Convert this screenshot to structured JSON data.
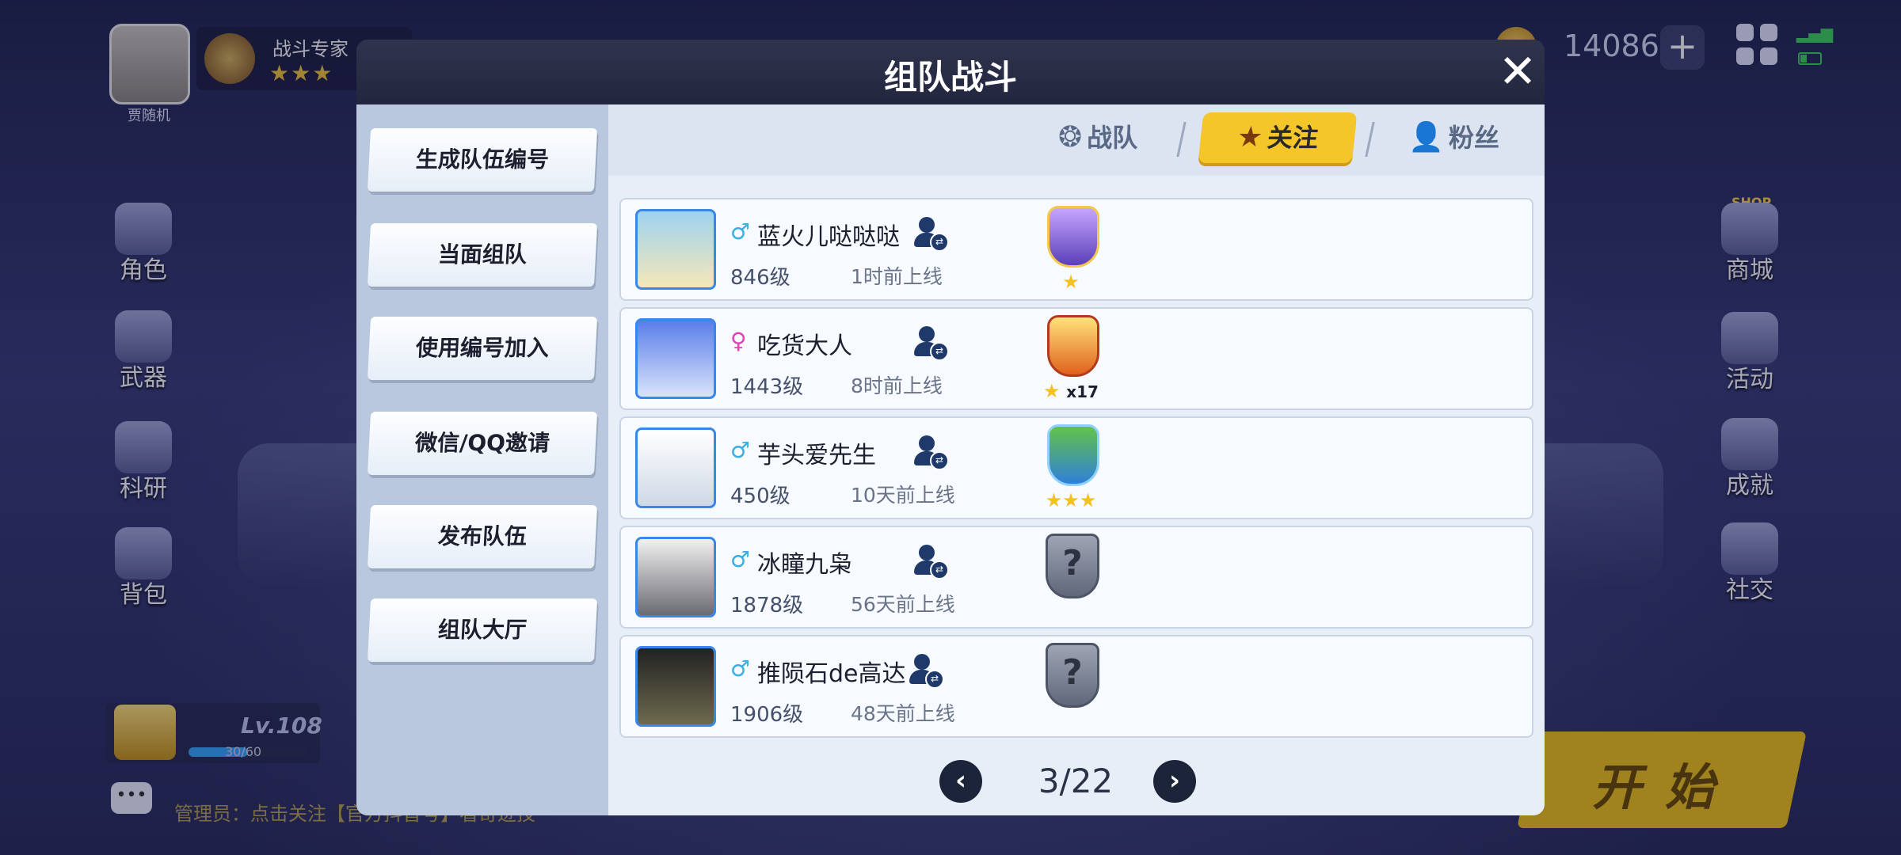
{
  "player": {
    "name": "贾随机",
    "rank_title": "战斗专家",
    "rank_stars": "★★★"
  },
  "resources": {
    "coins": "14086",
    "plus": "+"
  },
  "left_menu": [
    {
      "label": "角色"
    },
    {
      "label": "武器"
    },
    {
      "label": "科研"
    },
    {
      "label": "背包"
    }
  ],
  "right_menu": [
    {
      "label": "商城"
    },
    {
      "label": "活动"
    },
    {
      "label": "成就"
    },
    {
      "label": "社交"
    }
  ],
  "shop_badge": "SHOP",
  "level": {
    "text": "Lv.108",
    "xp": "30/60",
    "xp_fraction": 0.5
  },
  "chat": {
    "icon_text": "•••",
    "notice": "管理员：点击关注【官方抖音号】看奇迹技"
  },
  "start_button": {
    "label": "开始"
  },
  "dialog": {
    "title": "组队战斗",
    "close": "✕",
    "menu": [
      {
        "label": "生成队伍编号"
      },
      {
        "label": "当面组队"
      },
      {
        "label": "使用编号加入"
      },
      {
        "label": "微信/QQ邀请"
      },
      {
        "label": "发布队伍"
      },
      {
        "label": "组队大厅"
      }
    ],
    "tabs": [
      {
        "label": "战队",
        "icon": "team-emblem-icon",
        "active": false
      },
      {
        "label": "关注",
        "icon": "star-icon",
        "active": true
      },
      {
        "label": "粉丝",
        "icon": "add-user-icon",
        "active": false
      }
    ],
    "players": [
      {
        "gender": "♂",
        "name": "蓝火儿哒哒哒",
        "level": "846级",
        "online": "1时前上线",
        "badge": "purple-green-shield",
        "badge_stars": "★",
        "badge_count": ""
      },
      {
        "gender": "♀",
        "name": "吃货大人",
        "level": "1443级",
        "online": "8时前上线",
        "badge": "gold-shield",
        "badge_stars": "★",
        "badge_count": "x17"
      },
      {
        "gender": "♂",
        "name": "芋头爱先生",
        "level": "450级",
        "online": "10天前上线",
        "badge": "blue-plant-shield",
        "badge_stars": "★★★",
        "badge_count": ""
      },
      {
        "gender": "♂",
        "name": "冰瞳九枭",
        "level": "1878级",
        "online": "56天前上线",
        "badge": "unknown-shield",
        "badge_stars": "",
        "badge_count": ""
      },
      {
        "gender": "♂",
        "name": "推陨石de高达",
        "level": "1906级",
        "online": "48天前上线",
        "badge": "unknown-shield",
        "badge_stars": "",
        "badge_count": ""
      }
    ],
    "pager": {
      "prev": "‹",
      "page": "3/22",
      "next": "›"
    }
  },
  "colors": {
    "accent": "#f5c62a",
    "male": "#3aaee0",
    "female": "#e040b8",
    "avatar_border": "#3b87e8"
  }
}
